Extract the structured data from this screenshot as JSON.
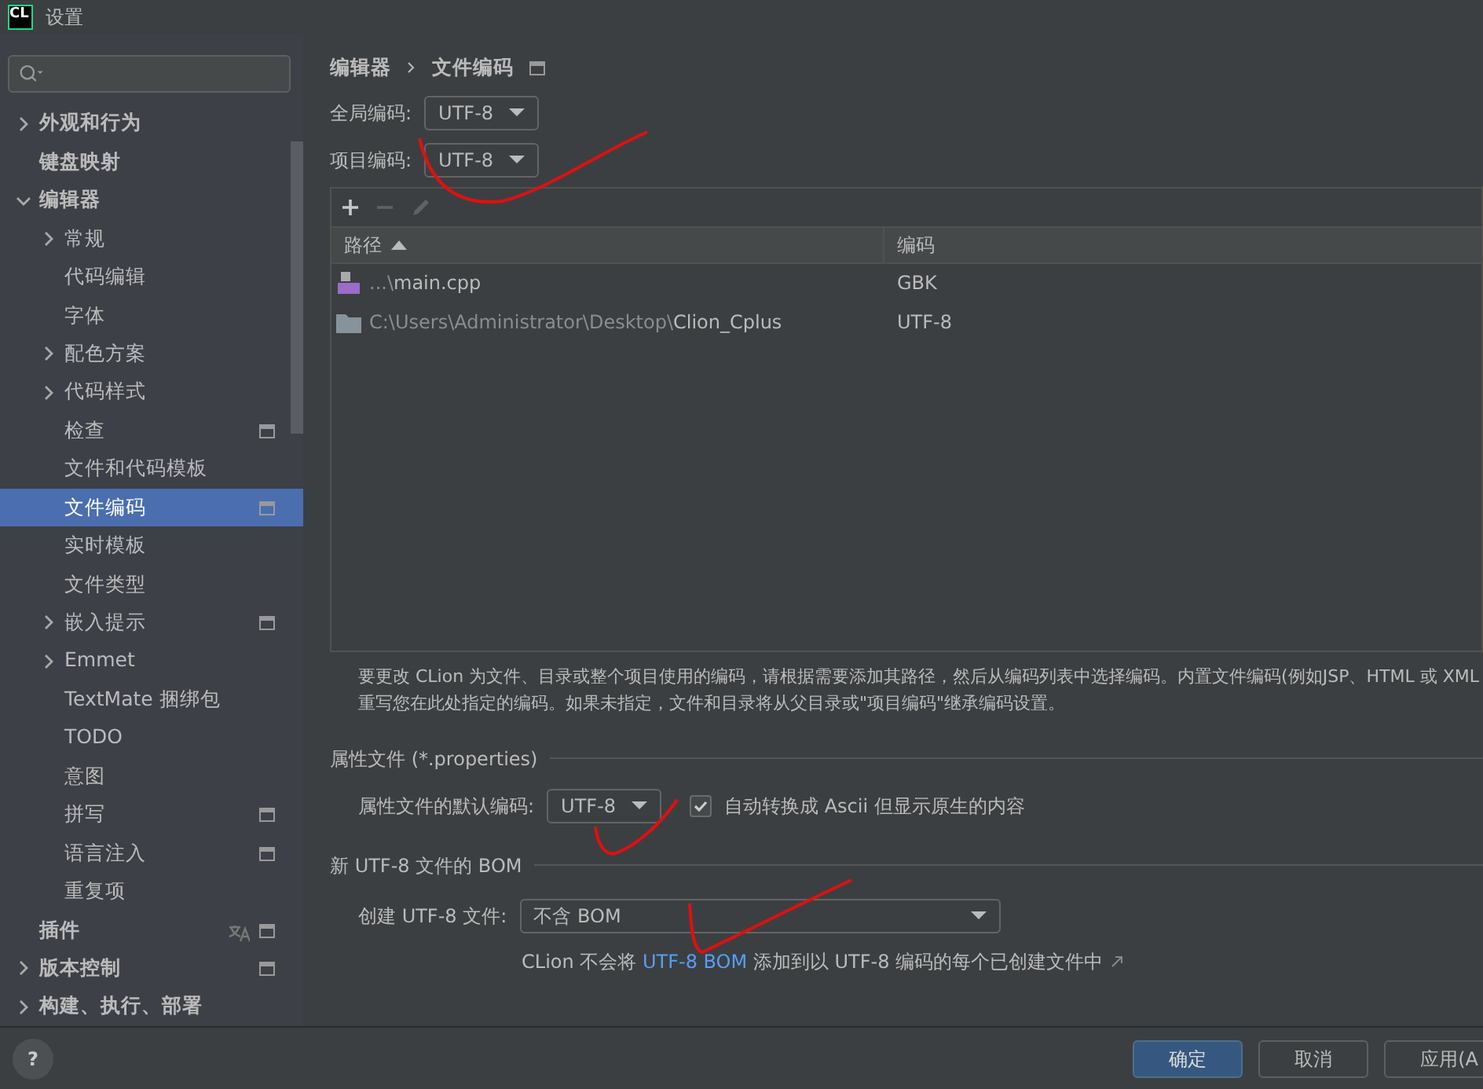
{
  "window": {
    "title": "设置",
    "logo": "CL"
  },
  "sidebar": {
    "items": [
      {
        "label": "外观和行为",
        "bold": true,
        "expanded": false,
        "has_children": true,
        "selected": false
      },
      {
        "label": "键盘映射",
        "bold": true,
        "has_children": false,
        "selected": false
      },
      {
        "label": "编辑器",
        "bold": true,
        "expanded": true,
        "has_children": true,
        "selected": false,
        "children": [
          {
            "label": "常规",
            "has_children": true,
            "expanded": false,
            "selected": false
          },
          {
            "label": "代码编辑",
            "has_children": false,
            "selected": false
          },
          {
            "label": "字体",
            "has_children": false,
            "selected": false
          },
          {
            "label": "配色方案",
            "has_children": true,
            "expanded": false,
            "selected": false
          },
          {
            "label": "代码样式",
            "has_children": true,
            "expanded": false,
            "selected": false
          },
          {
            "label": "检查",
            "has_children": false,
            "selected": false,
            "project_level": true
          },
          {
            "label": "文件和代码模板",
            "has_children": false,
            "selected": false
          },
          {
            "label": "文件编码",
            "has_children": false,
            "selected": true,
            "project_level": true
          },
          {
            "label": "实时模板",
            "has_children": false,
            "selected": false
          },
          {
            "label": "文件类型",
            "has_children": false,
            "selected": false
          },
          {
            "label": "嵌入提示",
            "has_children": true,
            "expanded": false,
            "selected": false,
            "project_level": true
          },
          {
            "label": "Emmet",
            "has_children": true,
            "expanded": false,
            "selected": false
          },
          {
            "label": "TextMate 捆绑包",
            "has_children": false,
            "selected": false
          },
          {
            "label": "TODO",
            "has_children": false,
            "selected": false
          },
          {
            "label": "意图",
            "has_children": false,
            "selected": false
          },
          {
            "label": "拼写",
            "has_children": false,
            "selected": false,
            "project_level": true
          },
          {
            "label": "语言注入",
            "has_children": false,
            "selected": false,
            "project_level": true
          },
          {
            "label": "重复项",
            "has_children": false,
            "selected": false
          }
        ]
      },
      {
        "label": "插件",
        "bold": true,
        "has_children": false,
        "selected": false,
        "translate": true,
        "project_level": true
      },
      {
        "label": "版本控制",
        "bold": true,
        "expanded": false,
        "has_children": true,
        "selected": false,
        "project_level": true
      },
      {
        "label": "构建、执行、部署",
        "bold": true,
        "expanded": false,
        "has_children": true,
        "selected": false
      }
    ]
  },
  "breadcrumb": [
    "编辑器",
    "文件编码"
  ],
  "global_encoding": {
    "label": "全局编码:",
    "value": "UTF-8"
  },
  "project_encoding": {
    "label": "项目编码:",
    "value": "UTF-8"
  },
  "table": {
    "toolbar": [
      {
        "kind": "add",
        "disabled": false
      },
      {
        "kind": "remove",
        "disabled": true
      },
      {
        "kind": "edit",
        "disabled": true
      }
    ],
    "columns": [
      {
        "label": "路径",
        "sorted": true
      },
      {
        "label": "编码"
      }
    ],
    "rows": [
      {
        "kind": "cpp",
        "path_prefix": "...\\",
        "name": "main.cpp",
        "encoding": "GBK"
      },
      {
        "kind": "folder",
        "path_prefix": "C:\\Users\\Administrator\\Desktop\\",
        "name": "Clion_Cplus",
        "encoding": "UTF-8"
      }
    ]
  },
  "help": [
    "要更改 CLion 为文件、目录或整个项目使用的编码，请根据需要添加其路径，然后从编码列表中选择编码。内置文件编码(例如JSP、HTML 或 XML",
    "重写您在此处指定的编码。如果未指定，文件和目录将从父目录或\"项目编码\"继承编码设置。"
  ],
  "properties": {
    "title": "属性文件 (*.properties)",
    "label": "属性文件的默认编码:",
    "value": "UTF-8",
    "checkbox": {
      "label": "自动转换成 Ascii 但显示原生的内容",
      "checked": true
    }
  },
  "bom": {
    "title": "新 UTF-8 文件的 BOM",
    "label": "创建 UTF-8 文件:",
    "value": "不含 BOM",
    "note_before": "CLion 不会将 ",
    "note_link": "UTF-8 BOM",
    "note_after": " 添加到以 UTF-8 编码的每个已创建文件中"
  },
  "help_button": "?",
  "buttons": [
    {
      "label": "确定",
      "primary": true
    },
    {
      "label": "取消",
      "primary": false
    },
    {
      "label": "应用(A",
      "primary": false
    }
  ]
}
